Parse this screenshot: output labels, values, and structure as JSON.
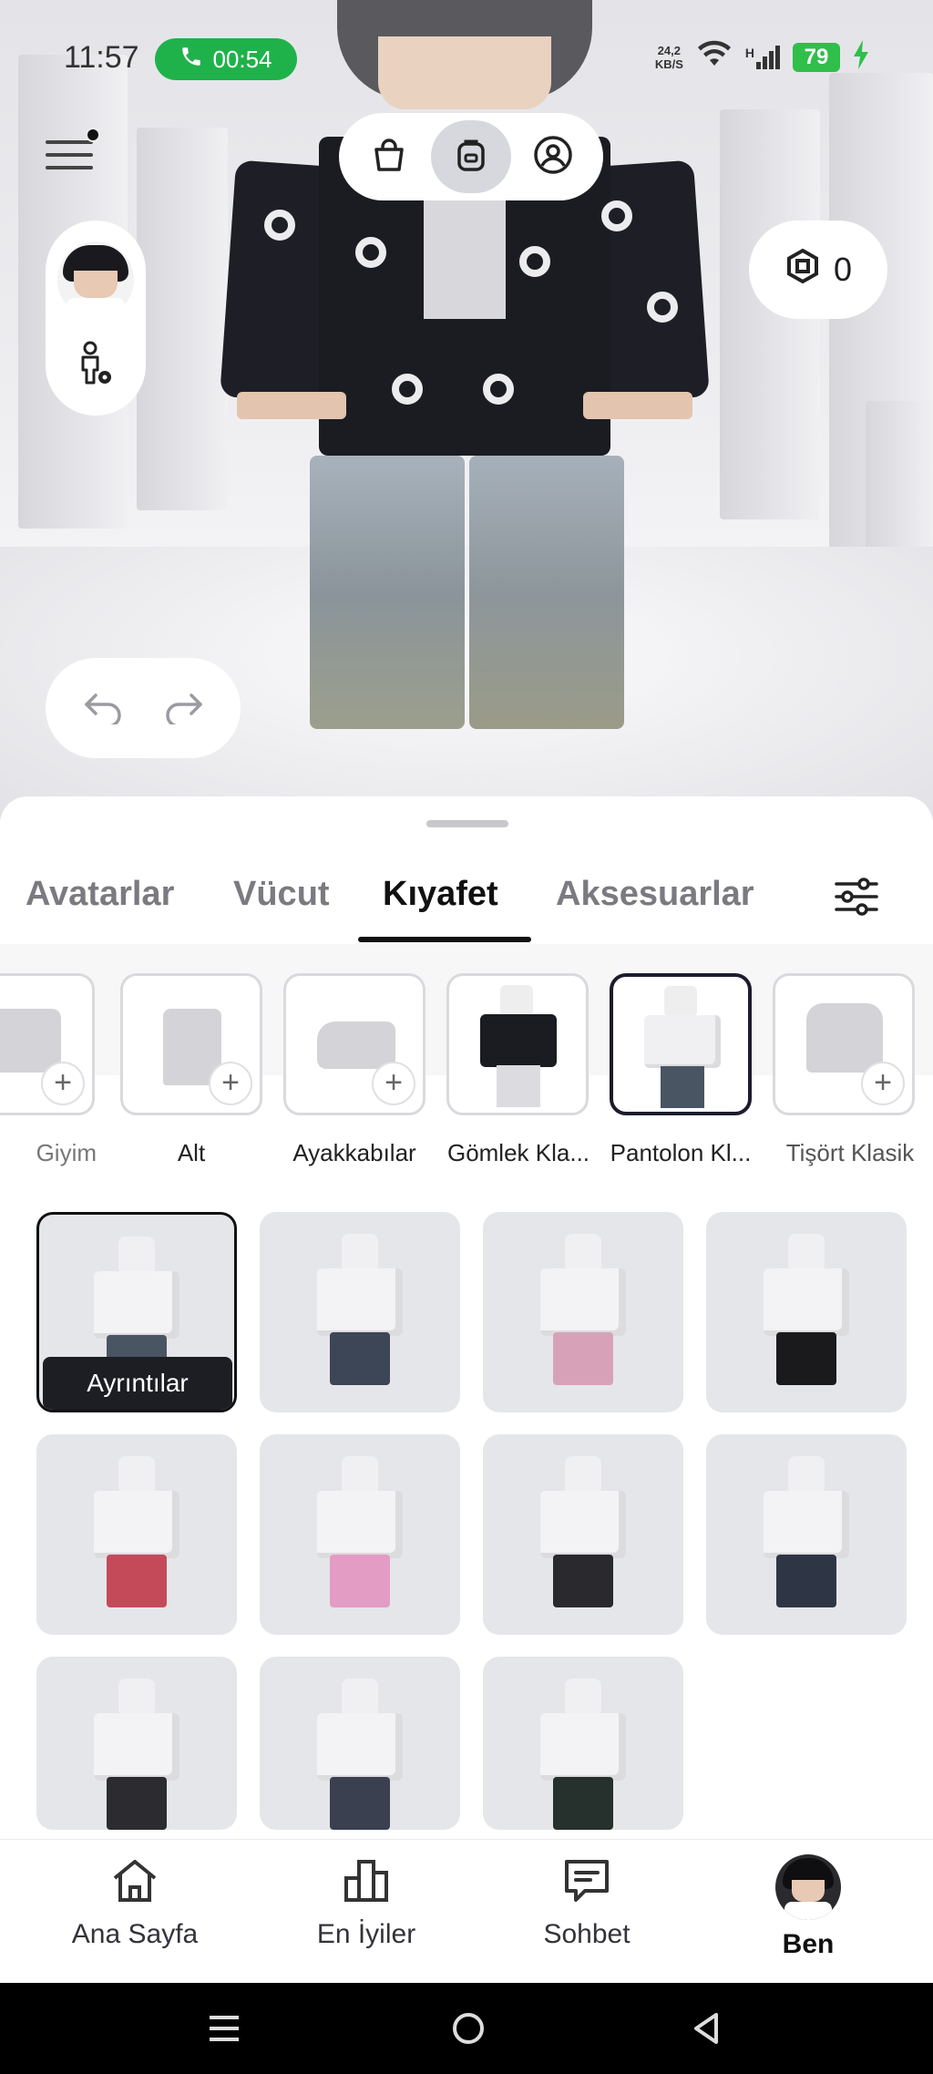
{
  "status_bar": {
    "time": "11:57",
    "call_duration": "00:54",
    "net_speed_top": "24,2",
    "net_speed_unit": "KB/S",
    "signal_type": "H",
    "battery": "79"
  },
  "robux": {
    "amount": "0"
  },
  "tabs": [
    "Avatarlar",
    "Vücut",
    "Kıyafet",
    "Aksesuarlar"
  ],
  "active_tab": "Kıyafet",
  "categories": [
    {
      "label": "Giyim"
    },
    {
      "label": "Alt"
    },
    {
      "label": "Ayakkabılar"
    },
    {
      "label": "Gömlek Kla..."
    },
    {
      "label": "Pantolon Kl..."
    },
    {
      "label": "Tişört Klasik"
    }
  ],
  "selected_category": "Pantolon Kl...",
  "details_label": "Ayrıntılar",
  "items": [
    {
      "legs": "#4a5563",
      "selected": true
    },
    {
      "legs": "#3c4656"
    },
    {
      "legs": "#d7a2b8"
    },
    {
      "legs": "#1a1a1c"
    },
    {
      "legs": "#c44a5a"
    },
    {
      "legs": "#e39cc4"
    },
    {
      "legs": "#2a2a2e"
    },
    {
      "legs": "#2e3646"
    },
    {
      "legs": "#2c2c30"
    },
    {
      "legs": "#3a4050"
    },
    {
      "legs": "#26302c"
    }
  ],
  "bottom_nav": [
    {
      "label": "Ana Sayfa",
      "icon": "home-icon"
    },
    {
      "label": "En İyiler",
      "icon": "leaderboard-icon"
    },
    {
      "label": "Sohbet",
      "icon": "chat-icon"
    },
    {
      "label": "Ben",
      "icon": "profile-avatar",
      "active": true
    }
  ],
  "colors": {
    "call_green": "#1fb24a",
    "battery_green": "#2fbf4a",
    "selected_border": "#1c1c2e"
  }
}
